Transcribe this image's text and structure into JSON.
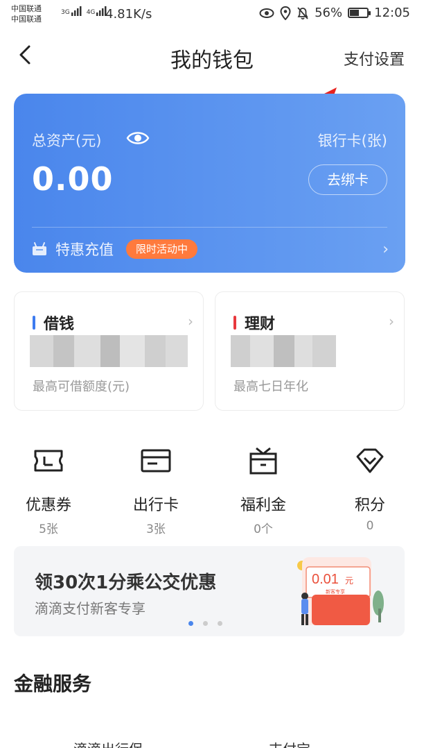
{
  "status_bar": {
    "carrier_1": "中国联通",
    "carrier_2": "中国联通",
    "net_1": "3G",
    "net_2": "4G",
    "speed": "4.81K/s",
    "battery": "56%",
    "battery_level": 0.56,
    "time": "12:05"
  },
  "header": {
    "title": "我的钱包",
    "pay_settings": "支付设置"
  },
  "wallet_card": {
    "assets_label": "总资产(元)",
    "assets_value": "0.00",
    "bank_label": "银行卡(张)",
    "bind_button": "去绑卡",
    "recharge_label": "特惠充值",
    "promo_badge": "限时活动中",
    "colors": {
      "gradient_start": "#4a86ec",
      "gradient_end": "#6aa0f2",
      "badge": "#ff7a3d"
    }
  },
  "finance_boxes": [
    {
      "title": "借钱",
      "subtitle": "最高可借额度(元)",
      "bar_color": "#3d7bf0"
    },
    {
      "title": "理财",
      "subtitle": "最高七日年化",
      "bar_color": "#e8383d"
    }
  ],
  "quick_items": [
    {
      "label": "优惠券",
      "count": "5张",
      "icon": "ticket-icon"
    },
    {
      "label": "出行卡",
      "count": "3张",
      "icon": "card-icon"
    },
    {
      "label": "福利金",
      "count": "0个",
      "icon": "gift-box-icon"
    },
    {
      "label": "积分",
      "count": "0",
      "icon": "diamond-icon"
    }
  ],
  "banner": {
    "title": "领30次1分乘公交优惠",
    "subtitle": "滴滴支付新客专享",
    "coupon_value": "0.01",
    "coupon_unit": "元",
    "coupon_tag": "新客专享",
    "dots_total": 3,
    "active_dot": 0
  },
  "section": {
    "title": "金融服务",
    "items_cut": [
      "滴滴出行保",
      "支付宝"
    ]
  }
}
